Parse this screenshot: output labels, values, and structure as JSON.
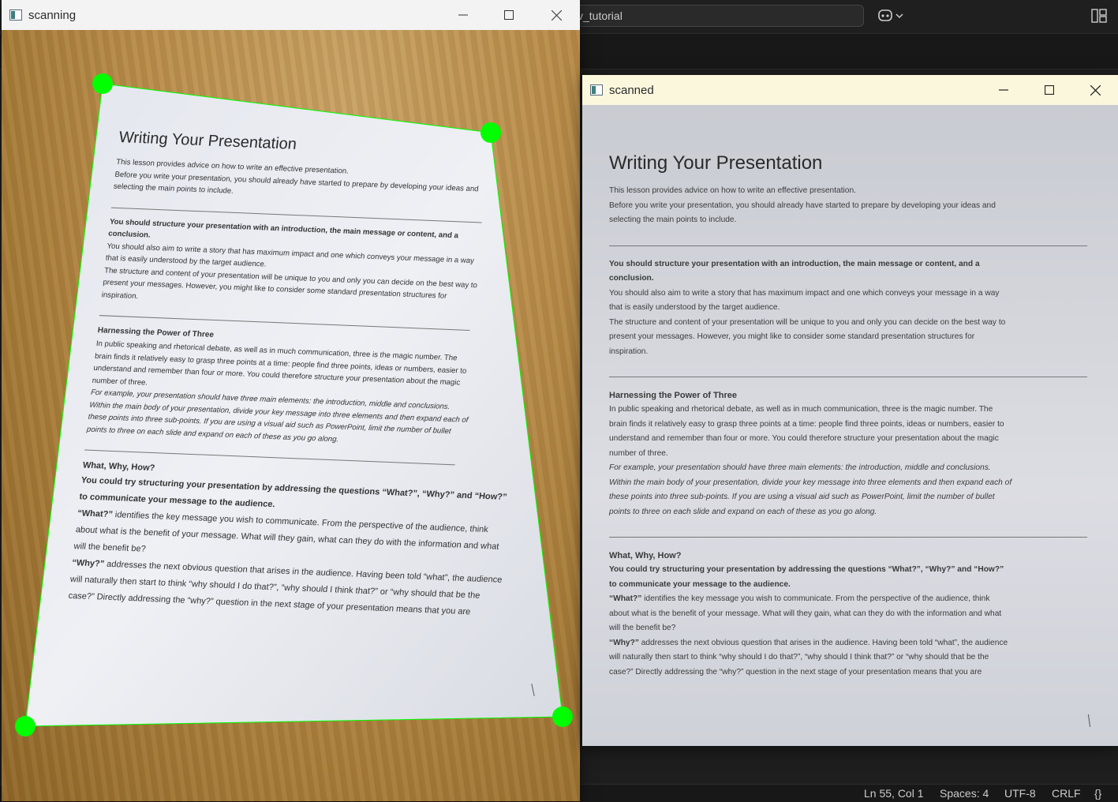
{
  "editor": {
    "command_center": "v_tutorial",
    "status": {
      "position": "Ln 55, Col 1",
      "spaces": "Spaces: 4",
      "encoding": "UTF-8",
      "eol": "CRLF",
      "lang_icon": "{}"
    }
  },
  "scanning_window": {
    "title": "scanning"
  },
  "scanned_window": {
    "title": "scanned"
  },
  "document": {
    "title": "Writing Your Presentation",
    "intro": [
      "This lesson provides advice on how to write an effective presentation.",
      "Before you write your presentation, you should already have started to prepare by developing your ideas and",
      "selecting the main points to include."
    ],
    "structure_bold": [
      "You should structure your presentation with an introduction, the main message or content, and a",
      "conclusion."
    ],
    "structure_text": [
      "You should also aim to write a story that has maximum impact and one which conveys your message in a way",
      "that is easily understood by the target audience.",
      "The structure and content of your presentation will be unique to you and only you can decide on the best way to",
      "present your messages.  However, you might like to consider some standard presentation structures for",
      "inspiration."
    ],
    "power_heading": "Harnessing the Power of Three",
    "power_text": [
      "In public speaking and rhetorical debate, as well as in much communication, three is the magic number.  The",
      "brain finds it relatively easy to grasp three points at a time: people find three points, ideas or numbers, easier to",
      "understand and remember than four or more.  You could therefore structure your presentation about the magic",
      "number of three."
    ],
    "power_italic": [
      "For example, your presentation should have three main elements: the introduction, middle and conclusions.",
      "Within the main body of your presentation, divide your key message into three elements and then expand each of",
      "these points into three sub-points.  If you are using a visual aid such as PowerPoint, limit the number of bullet",
      "points to three on each slide and expand on each of these as you go along."
    ],
    "why_heading": "What, Why, How?",
    "why_bold": [
      "You could try structuring your presentation by addressing the questions “What?”, “Why?” and “How?”",
      "to communicate your message to the audience."
    ],
    "what_lead": "“What?”",
    "what_rest": [
      " identifies the key message you wish to communicate.  From the perspective of the audience, think",
      "about what is the benefit of your message.  What will they gain, what can they do with the information and what",
      "will the benefit be?"
    ],
    "whyq_lead": "“Why?”",
    "whyq_rest": [
      " addresses the next obvious question that arises in the audience.  Having been told “what”, the audience",
      "will naturally then start to think “why should I do that?”, “why should I think that?” or “why should that be the",
      "case?”  Directly addressing the “why?” question in the next stage of your presentation means that you are"
    ]
  },
  "colors": {
    "corner_dot": "#00ff00",
    "scanned_titlebar": "#fbf7dd"
  }
}
